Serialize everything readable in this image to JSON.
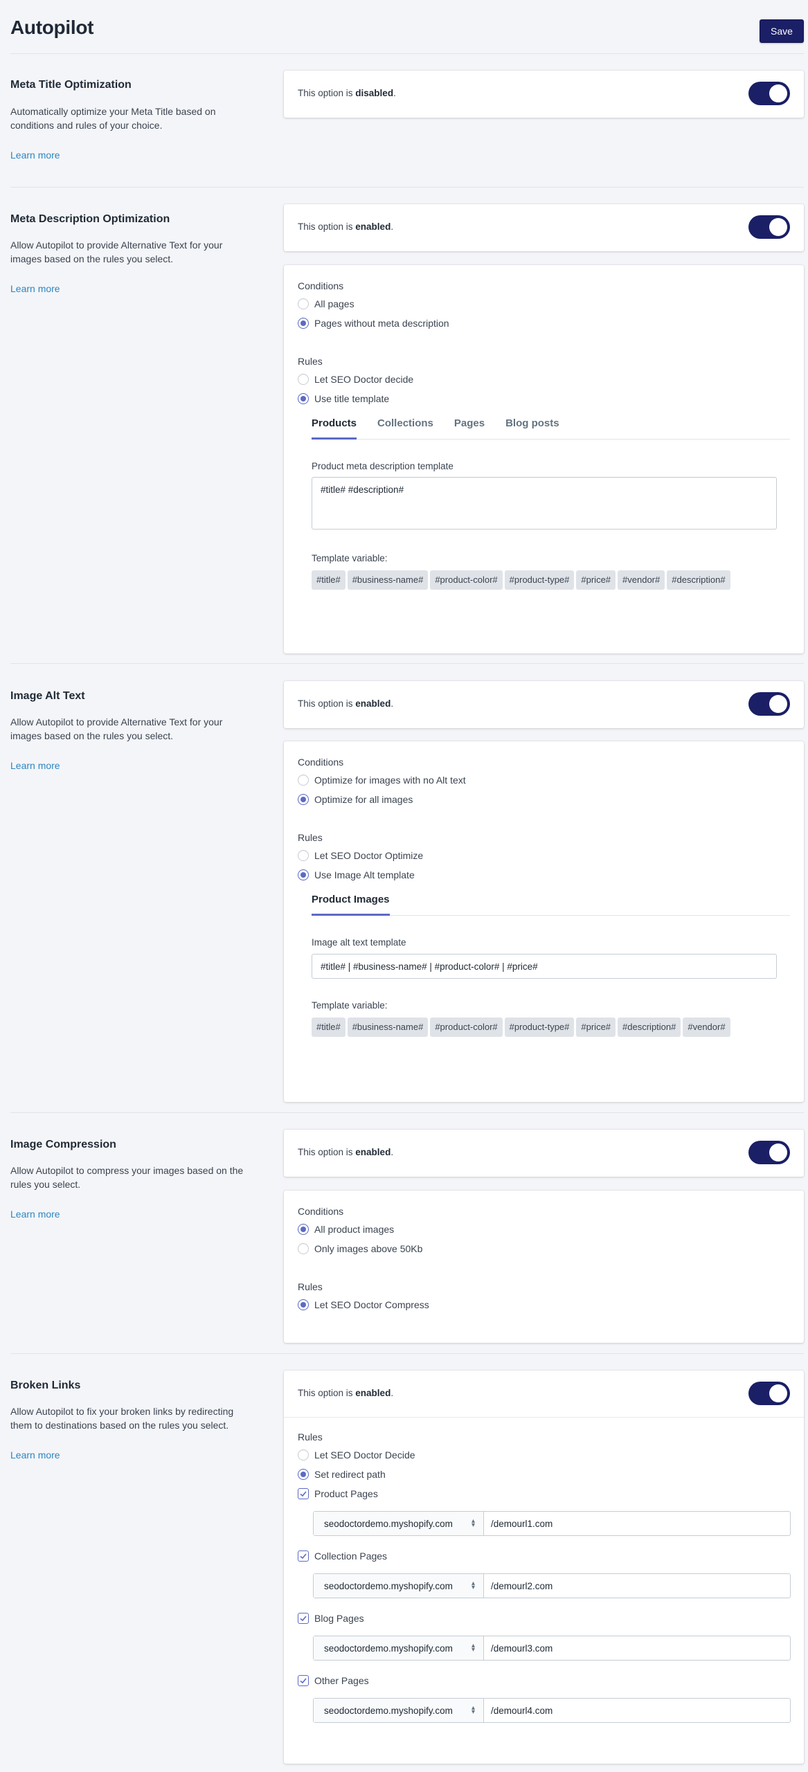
{
  "header": {
    "title": "Autopilot",
    "save_label": "Save"
  },
  "colors": {
    "primary": "#1b1f66",
    "accent": "#5c6ac4",
    "link": "#2e86c1",
    "background": "#f4f5f8"
  },
  "sections": [
    {
      "title": "Meta Title Optimization",
      "description": "Automatically optimize your Meta Title based on conditions and rules of your choice.",
      "learn_more": "Learn more",
      "status_prefix": "This option is ",
      "status_value": "disabled",
      "status_suffix": "."
    },
    {
      "title": "Meta Description Optimization",
      "description": "Allow Autopilot to provide Alternative Text for your images based on the rules you select.",
      "learn_more": "Learn more",
      "status_prefix": "This option is ",
      "status_value": "enabled",
      "status_suffix": ".",
      "conditions_label": "Conditions",
      "conditions": [
        {
          "label": "All pages",
          "selected": false
        },
        {
          "label": "Pages without meta description",
          "selected": true
        }
      ],
      "rules_label": "Rules",
      "rules": [
        {
          "label": "Let SEO Doctor decide",
          "selected": false
        },
        {
          "label": "Use title template",
          "selected": true
        }
      ],
      "tabs": [
        {
          "label": "Products",
          "active": true
        },
        {
          "label": "Collections",
          "active": false
        },
        {
          "label": "Pages",
          "active": false
        },
        {
          "label": "Blog posts",
          "active": false
        }
      ],
      "template_label": "Product meta description template",
      "template_value": "#title# #description#",
      "variables_label": "Template variable:",
      "variables": [
        "#title#",
        "#business-name#",
        "#product-color#",
        "#product-type#",
        "#price#",
        "#vendor#",
        "#description#"
      ]
    },
    {
      "title": "Image Alt Text",
      "description": "Allow Autopilot to provide Alternative Text for your images based on the rules you select.",
      "learn_more": "Learn more",
      "status_prefix": "This option is ",
      "status_value": "enabled",
      "status_suffix": ".",
      "conditions_label": "Conditions",
      "conditions": [
        {
          "label": "Optimize for images with no Alt text",
          "selected": false
        },
        {
          "label": "Optimize for all images",
          "selected": true
        }
      ],
      "rules_label": "Rules",
      "rules": [
        {
          "label": "Let SEO Doctor Optimize",
          "selected": false
        },
        {
          "label": "Use Image Alt template",
          "selected": true
        }
      ],
      "tabs": [
        {
          "label": "Product Images",
          "active": true
        }
      ],
      "template_label": "Image alt text template",
      "template_value": "#title# | #business-name# | #product-color# | #price#",
      "variables_label": "Template variable:",
      "variables": [
        "#title#",
        "#business-name#",
        "#product-color#",
        "#product-type#",
        "#price#",
        "#description#",
        "#vendor#"
      ]
    },
    {
      "title": "Image Compression",
      "description": "Allow Autopilot to compress your images based on the rules you select.",
      "learn_more": "Learn more",
      "status_prefix": "This option is ",
      "status_value": "enabled",
      "status_suffix": ".",
      "conditions_label": "Conditions",
      "conditions": [
        {
          "label": "All product images",
          "selected": true
        },
        {
          "label": "Only images above 50Kb",
          "selected": false
        }
      ],
      "rules_label": "Rules",
      "rules": [
        {
          "label": "Let SEO Doctor Compress",
          "selected": true
        }
      ]
    },
    {
      "title": "Broken Links",
      "description": "Allow Autopilot to fix your broken links by redirecting them to destinations based on the rules you select.",
      "learn_more": "Learn more",
      "status_prefix": "This option is ",
      "status_value": "enabled",
      "status_suffix": ".",
      "rules_label": "Rules",
      "rules": [
        {
          "label": "Let SEO Doctor Decide",
          "selected": false
        },
        {
          "label": "Set redirect path",
          "selected": true
        }
      ],
      "redirects": [
        {
          "label": "Product Pages",
          "checked": true,
          "domain": "seodoctordemo.myshopify.com",
          "path": "/demourl1.com"
        },
        {
          "label": "Collection Pages",
          "checked": true,
          "domain": "seodoctordemo.myshopify.com",
          "path": "/demourl2.com"
        },
        {
          "label": "Blog Pages",
          "checked": true,
          "domain": "seodoctordemo.myshopify.com",
          "path": "/demourl3.com"
        },
        {
          "label": "Other Pages",
          "checked": true,
          "domain": "seodoctordemo.myshopify.com",
          "path": "/demourl4.com"
        }
      ]
    }
  ]
}
